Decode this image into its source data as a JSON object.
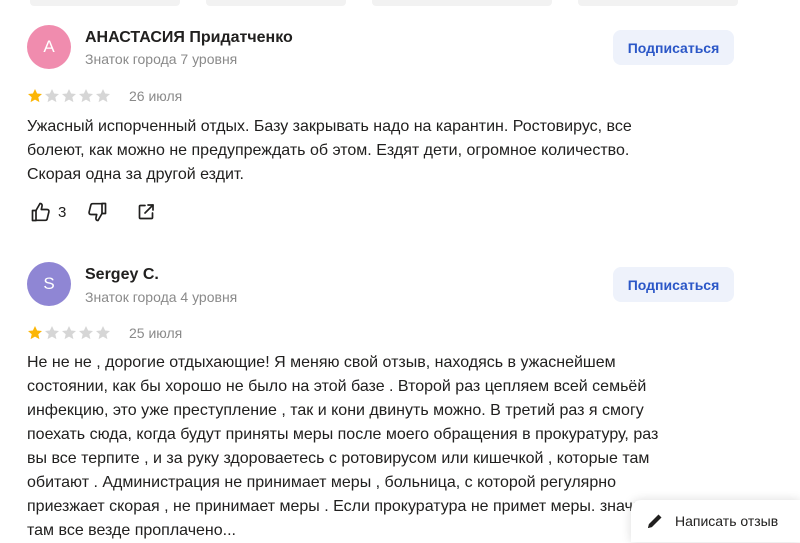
{
  "reviews": [
    {
      "avatar_letter": "А",
      "avatar_color": "#f08cae",
      "author": "АНАСТАСИЯ Придатченко",
      "level": "Знаток города 7 уровня",
      "subscribe_label": "Подписаться",
      "rating": 1,
      "max_rating": 5,
      "date": "26 июля",
      "text": "Ужасный испорченный отдых. Базу закрывать надо на карантин. Ростовирус, все\nболеют, как можно не предупреждать об этом. Ездят дети, огромное количество.\nСкорая одна за другой ездит.",
      "likes": "3"
    },
    {
      "avatar_letter": "S",
      "avatar_color": "#8f86d4",
      "author": "Sergey C.",
      "level": "Знаток города 4 уровня",
      "subscribe_label": "Подписаться",
      "rating": 1,
      "max_rating": 5,
      "date": "25 июля",
      "text": "Не не не , дорогие отдыхающие! Я меняю свой отзыв, находясь в ужаснейшем\nсостоянии, как бы хорошо не было на этой базе . Второй раз цепляем всей семьёй\nинфекцию, это уже преступление , так и кони двинуть можно. В третий раз я смогу\nпоехать сюда, когда будут приняты меры после моего обращения в прокуратуру, раз\nвы все терпите , и за руку здороваетесь с ротовирусом или кишечкой , которые там\nобитают . Администрация не принимает меры , больница, с которой регулярно\nприезжает скорая , не принимает меры . Если прокуратура не примет меры. значит\nтам все везде проплачено..."
    }
  ],
  "star_colors": {
    "filled": "#fcb606",
    "empty": "#d6d6d6"
  },
  "icons": {
    "like": "thumbs-up-icon",
    "dislike": "thumbs-down-icon",
    "share": "share-icon",
    "pen": "pen-icon"
  },
  "write_review_label": "Написать отзыв"
}
